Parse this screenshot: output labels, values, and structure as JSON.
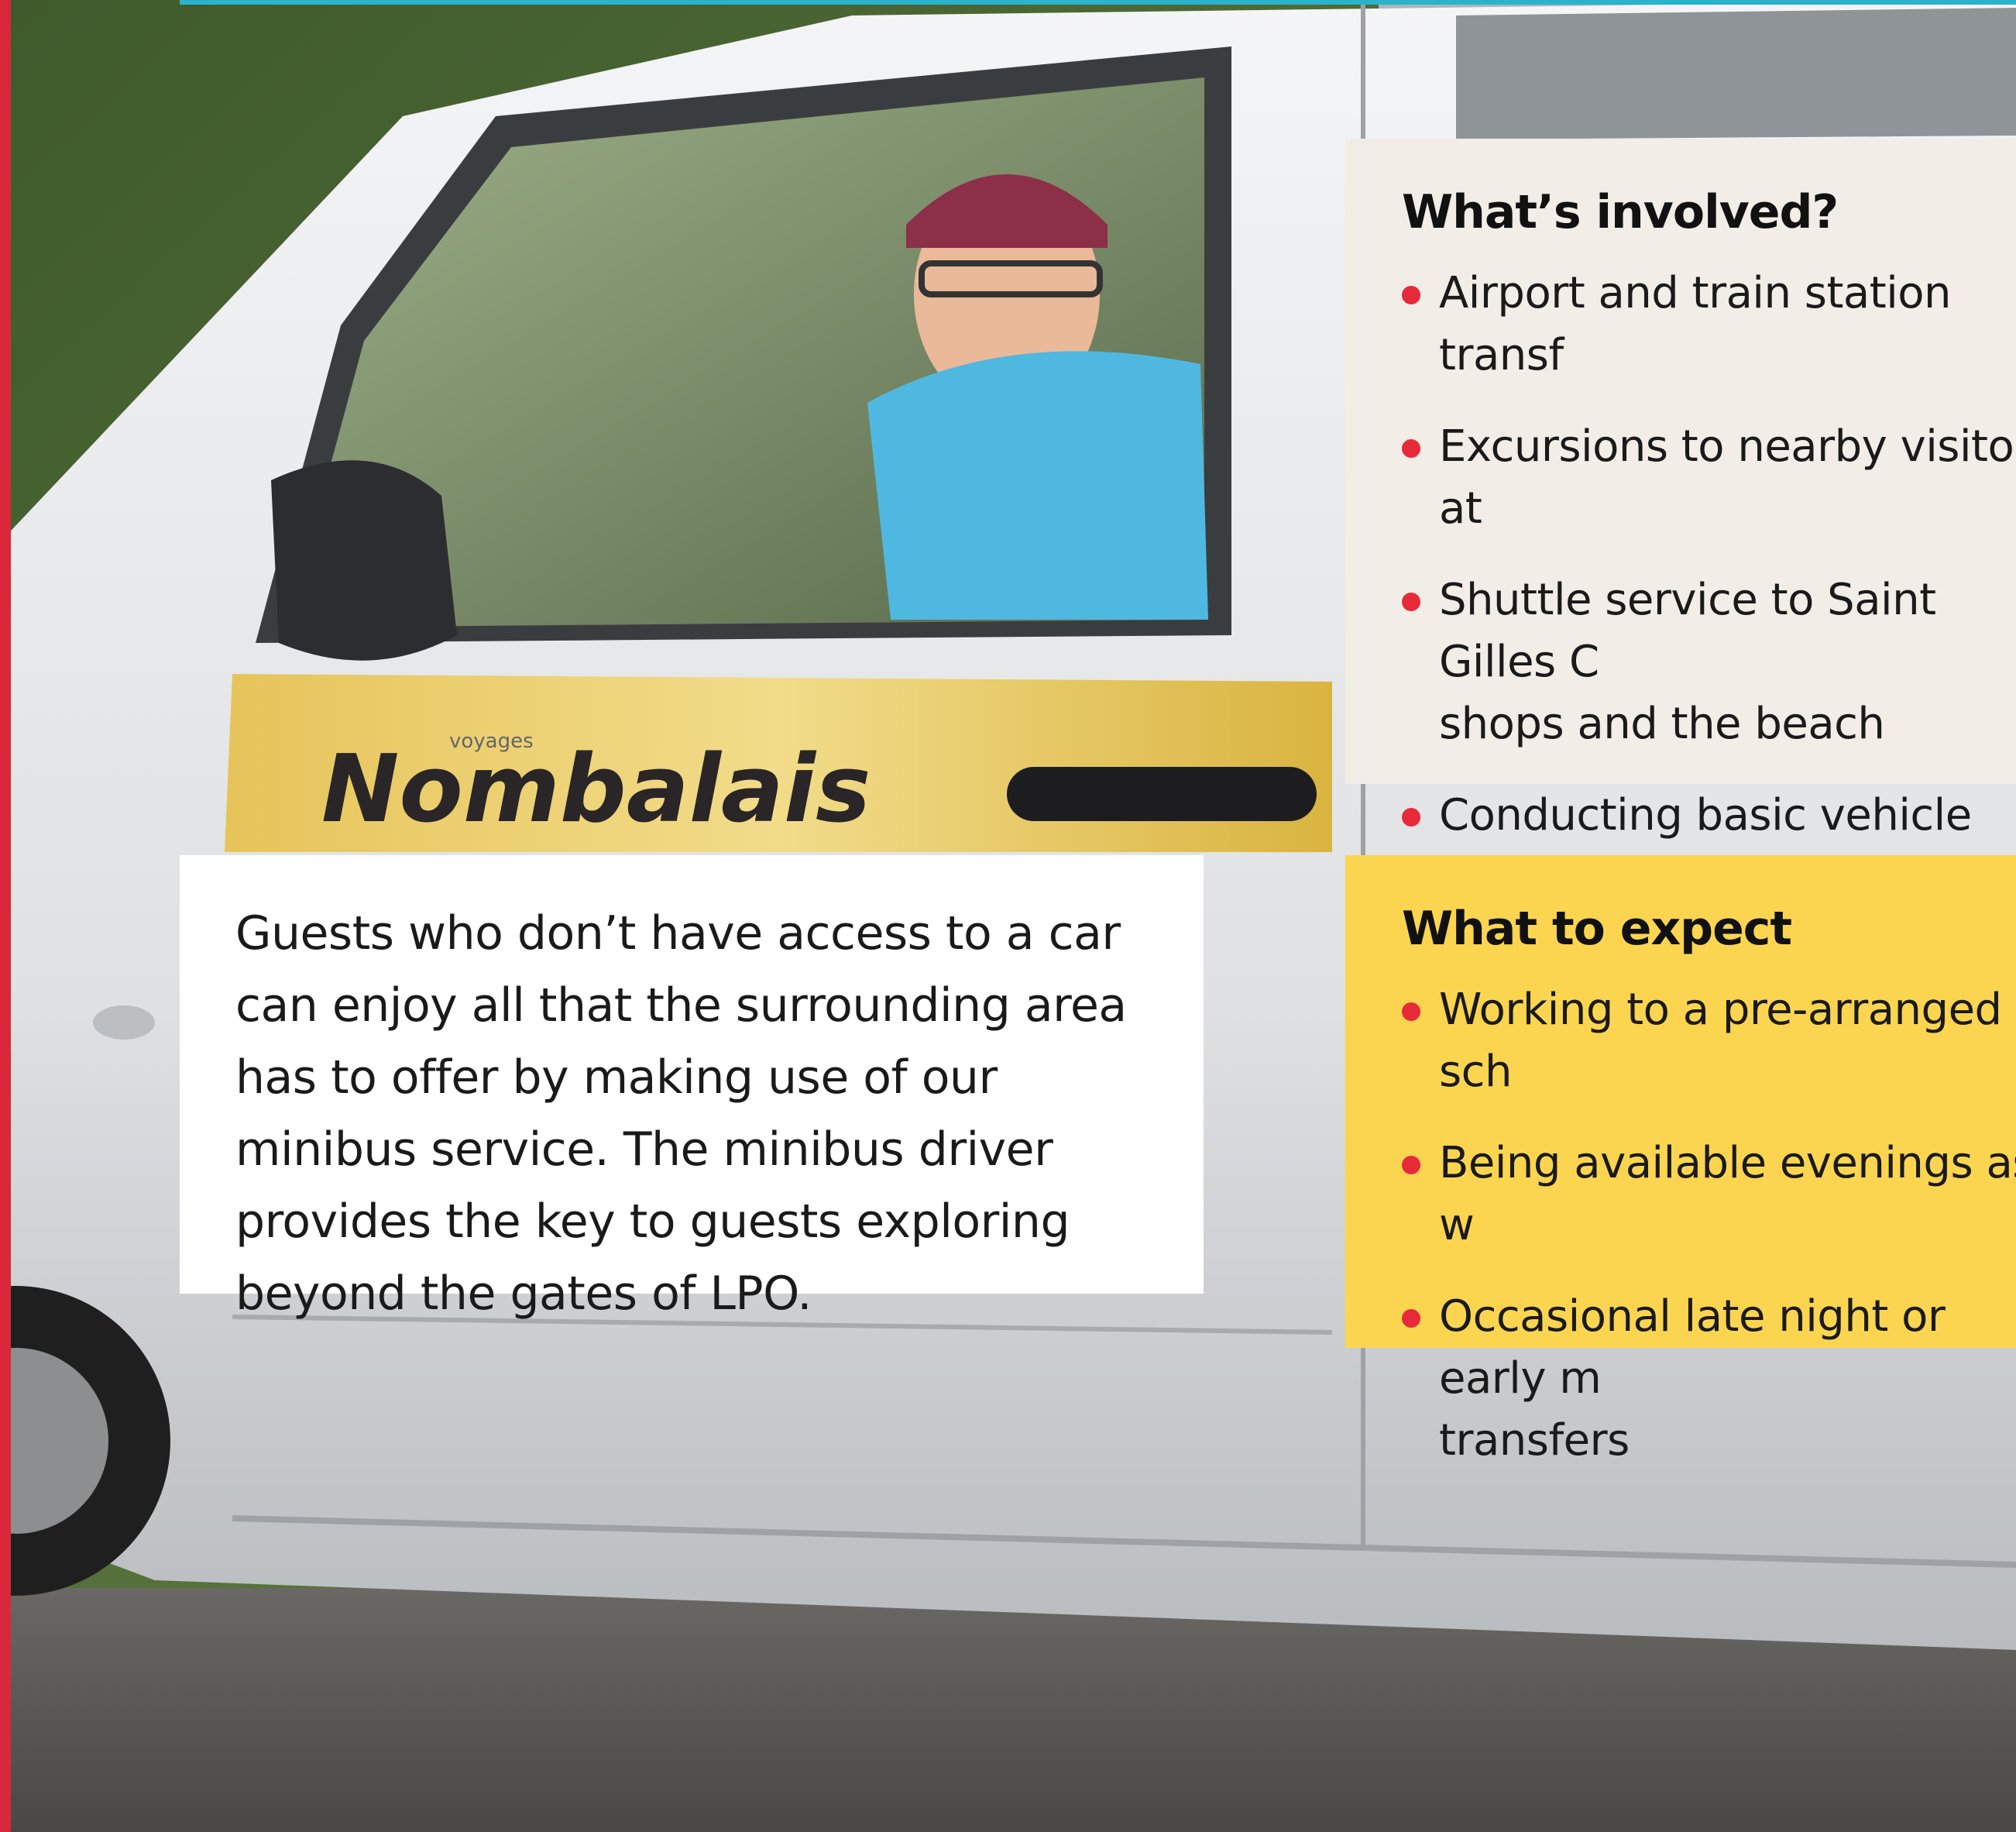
{
  "photo": {
    "logo_small": "voyages",
    "logo_main": "Nombalais"
  },
  "intro": {
    "text": "Guests who don’t have access to a car can enjoy all that the surrounding area has to offer by making use of our minibus service. The minibus driver provides the key to guests exploring beyond the gates of LPO."
  },
  "involved": {
    "heading": "What’s involved?",
    "items": [
      "Airport and train station transf",
      "Excursions to nearby visitor at",
      "Shuttle service to Saint Gilles C\nshops and the beach",
      "Conducting basic vehicle safet\neach journey"
    ]
  },
  "expect": {
    "heading": "What to expect",
    "items": [
      "Working to a pre-arranged sch",
      "Being available evenings as w",
      "Occasional late night or early m\ntransfers"
    ]
  },
  "colors": {
    "accent_red": "#e62a3a",
    "expect_bg": "#fcd550",
    "involved_bg": "#f2ede7",
    "frame_blue": "#2ab3cc"
  }
}
